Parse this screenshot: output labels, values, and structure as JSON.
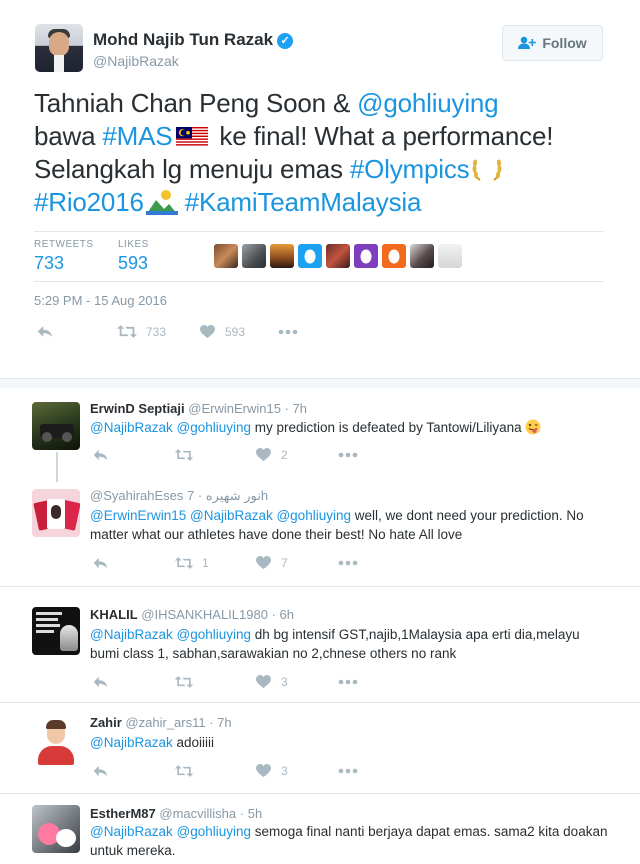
{
  "main_tweet": {
    "fullname": "Mohd Najib Tun Razak",
    "handle": "@NajibRazak",
    "follow_label": "Follow",
    "text": {
      "p1": "Tahniah Chan Peng Soon & ",
      "mention1": "@gohliuying",
      "p2": "bawa ",
      "hashtag_mas": "#MAS",
      "p3": " ke final! What a performance! Selangkah lg menuju emas ",
      "hashtag_olympics": "#Olympics",
      "hashtag_rio": "#Rio2016",
      "hashtag_kami": "#KamiTeamMalaysia"
    },
    "retweets_label": "RETWEETS",
    "retweets_count": "733",
    "likes_label": "LIKES",
    "likes_count": "593",
    "timestamp": "5:29 PM - 15 Aug 2016",
    "actions": {
      "retweets": "733",
      "likes": "593"
    }
  },
  "replies": [
    {
      "name": "ErwinD Septiaji",
      "handle": "@ErwinErwin15",
      "time": "· 7h",
      "mentions": "@NajibRazak @gohliuying",
      "text": " my prediction is defeated by Tantowi/Liliyana ",
      "retweets": "",
      "likes": "2"
    },
    {
      "name": "",
      "handle": "@SyahirahEses",
      "handle_rtl": "نور شهيره",
      "time": "· 7h",
      "mentions": "@ErwinErwin15 @NajibRazak @gohliuying",
      "text": " well, we dont need your prediction. No matter what our athletes have done their best! No hate All love",
      "retweets": "1",
      "likes": "7"
    },
    {
      "name": "KHALIL",
      "handle": "@IHSANKHALIL1980",
      "time": "· 6h",
      "mentions": "@NajibRazak @gohliuying",
      "text": " dh bg intensif GST,najib,1Malaysia apa erti dia,melayu bumi class 1, sabhan,sarawakian no 2,chnese others no rank",
      "retweets": "",
      "likes": "3"
    },
    {
      "name": "Zahir",
      "handle": "@zahir_ars11",
      "time": "· 7h",
      "mentions": "@NajibRazak",
      "text": " adoiiiii",
      "retweets": "",
      "likes": "3"
    },
    {
      "name": "EstherM87",
      "handle": "@macvillisha",
      "time": "· 5h",
      "mentions": "@NajibRazak @gohliuying",
      "text": " semoga final nanti berjaya dapat emas. sama2 kita doakan untuk mereka.",
      "retweets": "",
      "likes": ""
    }
  ],
  "icons": [
    "reply-icon",
    "retweet-icon",
    "heart-icon",
    "more-icon",
    "verified-icon",
    "follow-user-icon"
  ],
  "colors": {
    "link": "#1b95e0",
    "muted": "#8899a6",
    "icon": "#aab8c2",
    "verified": "#1da1f2"
  }
}
